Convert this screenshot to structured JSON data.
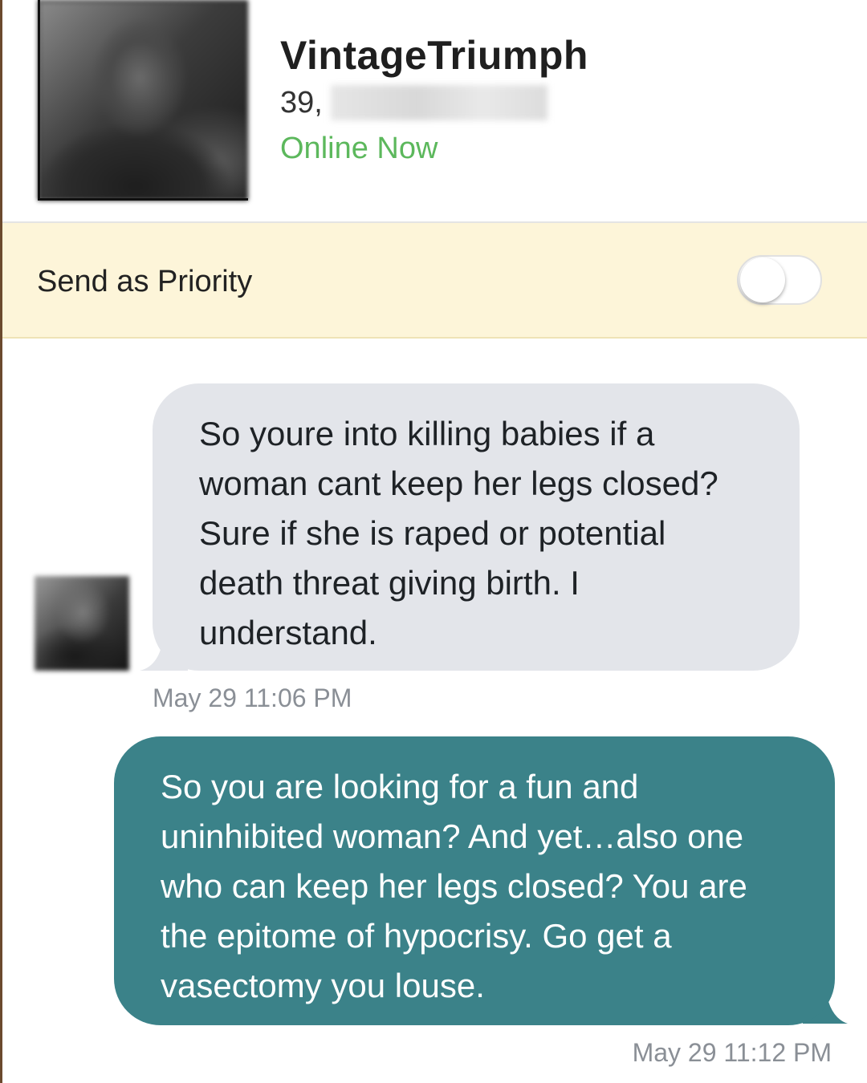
{
  "profile": {
    "username": "VintageTriumph",
    "age": "39,",
    "status": "Online Now",
    "status_color": "#5cb85c",
    "avatar_icon": "profile-photo-blurred"
  },
  "priority": {
    "label": "Send as Priority",
    "enabled": false,
    "background_color": "#fdf5d9"
  },
  "messages": [
    {
      "direction": "incoming",
      "lines": [
        "So youre into killing babies if a",
        "woman cant keep her legs closed?",
        "Sure if she is raped or potential",
        "death threat giving birth.  I",
        "understand."
      ],
      "timestamp": "May 29 11:06 PM",
      "bubble_color": "#e3e5ea"
    },
    {
      "direction": "outgoing",
      "lines": [
        "So you are looking for a fun and",
        "uninhibited woman? And yet…also one",
        "who can keep her legs closed? You are",
        "the epitome of hypocrisy. Go get a",
        "vasectomy you louse."
      ],
      "timestamp": "May 29 11:12 PM",
      "bubble_color": "#3b8289"
    }
  ]
}
